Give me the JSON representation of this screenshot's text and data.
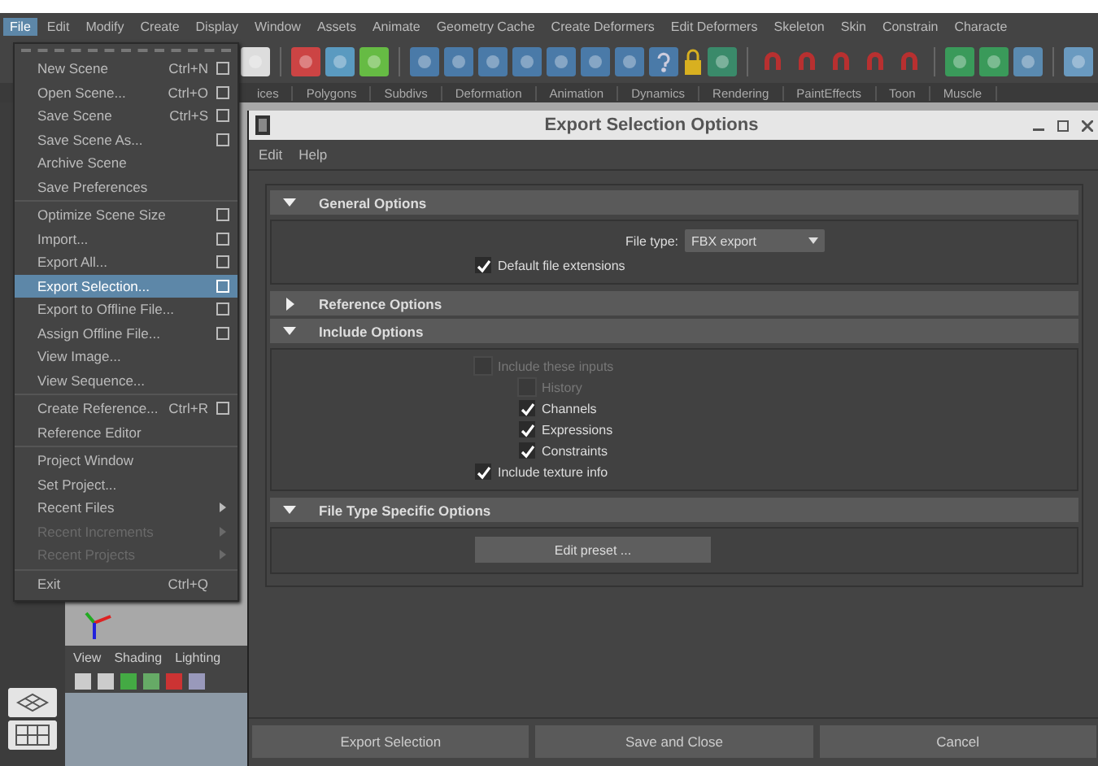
{
  "menubar": [
    {
      "label": "File",
      "selected": true
    },
    {
      "label": "Edit",
      "selected": false
    },
    {
      "label": "Modify",
      "selected": false
    },
    {
      "label": "Create",
      "selected": false
    },
    {
      "label": "Display",
      "selected": false
    },
    {
      "label": "Window",
      "selected": false
    },
    {
      "label": "Assets",
      "selected": false
    },
    {
      "label": "Animate",
      "selected": false
    },
    {
      "label": "Geometry Cache",
      "selected": false
    },
    {
      "label": "Create Deformers",
      "selected": false
    },
    {
      "label": "Edit Deformers",
      "selected": false
    },
    {
      "label": "Skeleton",
      "selected": false
    },
    {
      "label": "Skin",
      "selected": false
    },
    {
      "label": "Constrain",
      "selected": false
    },
    {
      "label": "Characte",
      "selected": false
    }
  ],
  "shelf_tabs": [
    "ices",
    "Polygons",
    "Subdivs",
    "Deformation",
    "Animation",
    "Dynamics",
    "Rendering",
    "PaintEffects",
    "Toon",
    "Muscle"
  ],
  "file_menu": {
    "groups": [
      {
        "items": [
          {
            "label": "New Scene",
            "shortcut": "Ctrl+N",
            "option_box": true,
            "submenu": false,
            "disabled": false,
            "selected": false
          },
          {
            "label": "Open Scene...",
            "shortcut": "Ctrl+O",
            "option_box": true,
            "submenu": false,
            "disabled": false,
            "selected": false
          },
          {
            "label": "Save Scene",
            "shortcut": "Ctrl+S",
            "option_box": true,
            "submenu": false,
            "disabled": false,
            "selected": false
          },
          {
            "label": "Save Scene As...",
            "option_box": true,
            "submenu": false,
            "disabled": false,
            "selected": false
          },
          {
            "label": "Archive Scene",
            "option_box": false,
            "submenu": false,
            "disabled": false,
            "selected": false
          },
          {
            "label": "Save Preferences",
            "option_box": false,
            "submenu": false,
            "disabled": false,
            "selected": false
          }
        ]
      },
      {
        "items": [
          {
            "label": "Optimize Scene Size",
            "option_box": true,
            "submenu": false,
            "disabled": false,
            "selected": false
          },
          {
            "label": "Import...",
            "option_box": true,
            "submenu": false,
            "disabled": false,
            "selected": false
          },
          {
            "label": "Export All...",
            "option_box": true,
            "submenu": false,
            "disabled": false,
            "selected": false
          },
          {
            "label": "Export Selection...",
            "option_box": true,
            "submenu": false,
            "disabled": false,
            "selected": true
          },
          {
            "label": "Export to Offline File...",
            "option_box": true,
            "submenu": false,
            "disabled": false,
            "selected": false
          },
          {
            "label": "Assign Offline File...",
            "option_box": true,
            "submenu": false,
            "disabled": false,
            "selected": false
          },
          {
            "label": "View Image...",
            "option_box": false,
            "submenu": false,
            "disabled": false,
            "selected": false
          },
          {
            "label": "View Sequence...",
            "option_box": false,
            "submenu": false,
            "disabled": false,
            "selected": false
          }
        ]
      },
      {
        "items": [
          {
            "label": "Create Reference...",
            "shortcut": "Ctrl+R",
            "option_box": true,
            "submenu": false,
            "disabled": false,
            "selected": false
          },
          {
            "label": "Reference Editor",
            "option_box": false,
            "submenu": false,
            "disabled": false,
            "selected": false
          }
        ]
      },
      {
        "items": [
          {
            "label": "Project Window",
            "option_box": false,
            "submenu": false,
            "disabled": false,
            "selected": false
          },
          {
            "label": "Set Project...",
            "option_box": false,
            "submenu": false,
            "disabled": false,
            "selected": false
          },
          {
            "label": "Recent Files",
            "option_box": false,
            "submenu": true,
            "disabled": false,
            "selected": false
          },
          {
            "label": "Recent Increments",
            "option_box": false,
            "submenu": true,
            "disabled": true,
            "selected": false
          },
          {
            "label": "Recent Projects",
            "option_box": false,
            "submenu": true,
            "disabled": true,
            "selected": false
          }
        ]
      },
      {
        "items": [
          {
            "label": "Exit",
            "shortcut": "Ctrl+Q",
            "option_box": false,
            "submenu": false,
            "disabled": false,
            "selected": false
          }
        ]
      }
    ]
  },
  "viewport": {
    "menu": [
      "View",
      "Shading",
      "Lighting"
    ]
  },
  "dialog": {
    "title": "Export Selection Options",
    "menu": [
      "Edit",
      "Help"
    ],
    "sections": [
      {
        "title": "General Options",
        "expanded": true,
        "content": [
          {
            "kind": "dropdown",
            "label": "File type:",
            "value": "FBX export"
          },
          {
            "kind": "checkbox",
            "label": "Default file extensions",
            "checked": true,
            "disabled": false
          }
        ]
      },
      {
        "title": "Reference Options",
        "expanded": false
      },
      {
        "title": "Include Options",
        "expanded": true,
        "content": [
          {
            "kind": "checkbox",
            "label": "Include these inputs",
            "checked": false,
            "disabled": true,
            "children": [
              {
                "kind": "checkbox",
                "label": "History",
                "checked": false,
                "disabled": true
              },
              {
                "kind": "checkbox",
                "label": "Channels",
                "checked": true,
                "disabled": false
              },
              {
                "kind": "checkbox",
                "label": "Expressions",
                "checked": true,
                "disabled": false
              },
              {
                "kind": "checkbox",
                "label": "Constraints",
                "checked": true,
                "disabled": false
              }
            ]
          },
          {
            "kind": "checkbox",
            "label": "Include texture info",
            "checked": true,
            "disabled": false
          }
        ]
      },
      {
        "title": "File Type Specific Options",
        "expanded": true,
        "content": [
          {
            "kind": "button",
            "label": "Edit preset ..."
          }
        ]
      }
    ],
    "buttons": [
      "Export Selection",
      "Save and Close",
      "Cancel"
    ]
  }
}
